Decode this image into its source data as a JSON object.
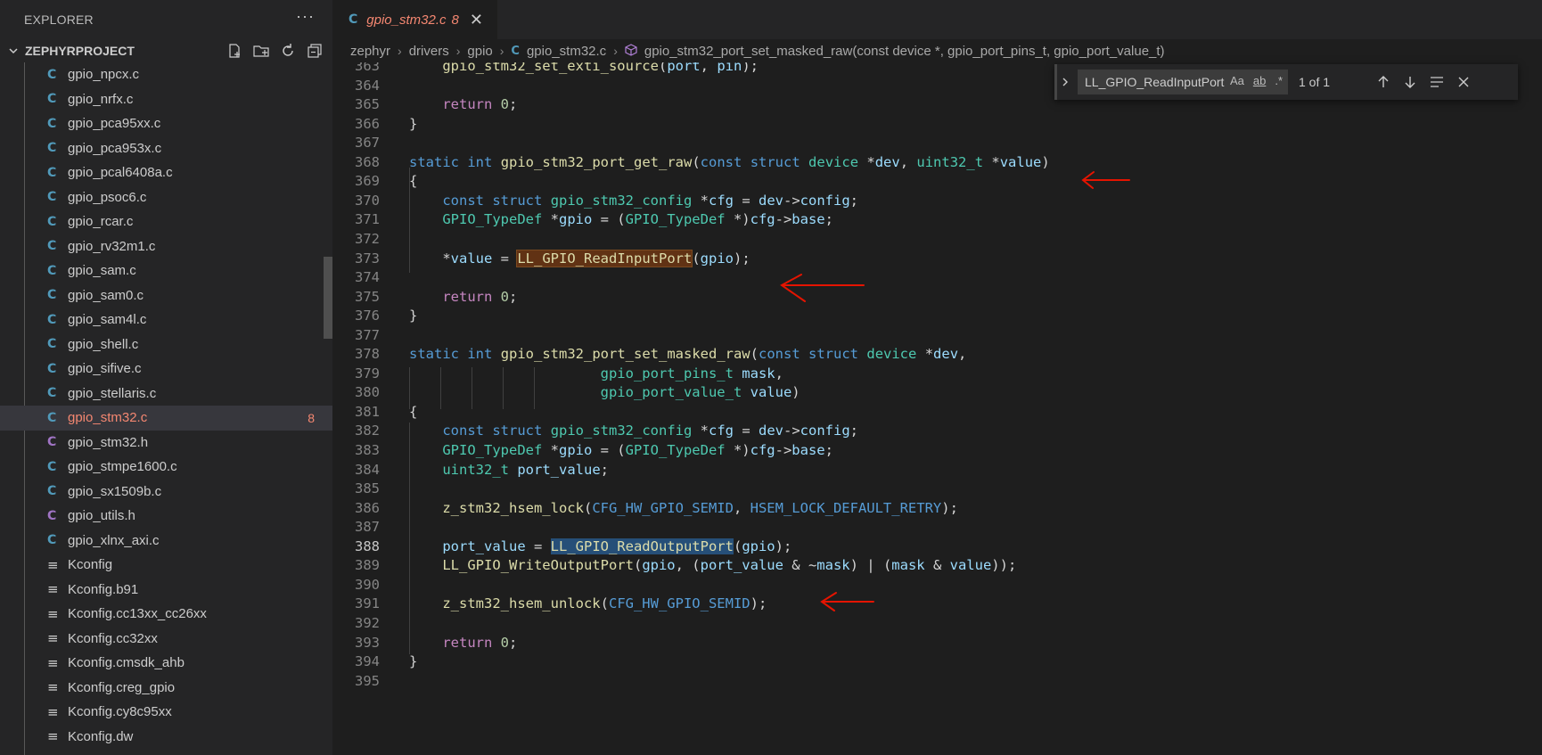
{
  "sidebar": {
    "title": "EXPLORER",
    "more": "···",
    "project": "ZEPHYRPROJECT",
    "files": [
      {
        "icon": "C",
        "kind": "c",
        "name": "gpio_npcx.c"
      },
      {
        "icon": "C",
        "kind": "c",
        "name": "gpio_nrfx.c"
      },
      {
        "icon": "C",
        "kind": "c",
        "name": "gpio_pca95xx.c"
      },
      {
        "icon": "C",
        "kind": "c",
        "name": "gpio_pca953x.c"
      },
      {
        "icon": "C",
        "kind": "c",
        "name": "gpio_pcal6408a.c"
      },
      {
        "icon": "C",
        "kind": "c",
        "name": "gpio_psoc6.c"
      },
      {
        "icon": "C",
        "kind": "c",
        "name": "gpio_rcar.c"
      },
      {
        "icon": "C",
        "kind": "c",
        "name": "gpio_rv32m1.c"
      },
      {
        "icon": "C",
        "kind": "c",
        "name": "gpio_sam.c"
      },
      {
        "icon": "C",
        "kind": "c",
        "name": "gpio_sam0.c"
      },
      {
        "icon": "C",
        "kind": "c",
        "name": "gpio_sam4l.c"
      },
      {
        "icon": "C",
        "kind": "c",
        "name": "gpio_shell.c"
      },
      {
        "icon": "C",
        "kind": "c",
        "name": "gpio_sifive.c"
      },
      {
        "icon": "C",
        "kind": "c",
        "name": "gpio_stellaris.c"
      },
      {
        "icon": "C",
        "kind": "c",
        "name": "gpio_stm32.c",
        "active": true,
        "badge": "8"
      },
      {
        "icon": "C",
        "kind": "h",
        "name": "gpio_stm32.h"
      },
      {
        "icon": "C",
        "kind": "c",
        "name": "gpio_stmpe1600.c"
      },
      {
        "icon": "C",
        "kind": "c",
        "name": "gpio_sx1509b.c"
      },
      {
        "icon": "C",
        "kind": "h",
        "name": "gpio_utils.h"
      },
      {
        "icon": "C",
        "kind": "c",
        "name": "gpio_xlnx_axi.c"
      },
      {
        "icon": "≡",
        "kind": "k",
        "name": "Kconfig"
      },
      {
        "icon": "≡",
        "kind": "k",
        "name": "Kconfig.b91"
      },
      {
        "icon": "≡",
        "kind": "k",
        "name": "Kconfig.cc13xx_cc26xx"
      },
      {
        "icon": "≡",
        "kind": "k",
        "name": "Kconfig.cc32xx"
      },
      {
        "icon": "≡",
        "kind": "k",
        "name": "Kconfig.cmsdk_ahb"
      },
      {
        "icon": "≡",
        "kind": "k",
        "name": "Kconfig.creg_gpio"
      },
      {
        "icon": "≡",
        "kind": "k",
        "name": "Kconfig.cy8c95xx"
      },
      {
        "icon": "≡",
        "kind": "k",
        "name": "Kconfig.dw"
      }
    ]
  },
  "tab": {
    "icon": "C",
    "name": "gpio_stm32.c",
    "count": "8",
    "close": "✕"
  },
  "breadcrumb": {
    "parts": [
      "zephyr",
      "drivers",
      "gpio"
    ],
    "file_icon": "C",
    "file": "gpio_stm32.c",
    "symbol": "gpio_stm32_port_set_masked_raw(const device *, gpio_port_pins_t, gpio_port_value_t)"
  },
  "find": {
    "query": "LL_GPIO_ReadInputPort",
    "match_case": "Aa",
    "whole_word": "ab",
    "regex": ".*",
    "count": "1 of 1"
  },
  "code": {
    "current_line": "388",
    "lines": [
      {
        "n": "363",
        "t": [
          [
            "pl",
            "    "
          ],
          [
            "fn",
            "gpio_stm32_set_exti_source"
          ],
          [
            "pl",
            "("
          ],
          [
            "id",
            "port"
          ],
          [
            "pl",
            ", "
          ],
          [
            "id",
            "pin"
          ],
          [
            "pl",
            ");"
          ]
        ]
      },
      {
        "n": "364",
        "t": []
      },
      {
        "n": "365",
        "t": [
          [
            "pl",
            "    "
          ],
          [
            "ctl",
            "return"
          ],
          [
            "pl",
            " "
          ],
          [
            "num",
            "0"
          ],
          [
            "pl",
            ";"
          ]
        ]
      },
      {
        "n": "366",
        "t": [
          [
            "pl",
            "}"
          ]
        ]
      },
      {
        "n": "367",
        "t": []
      },
      {
        "n": "368",
        "t": [
          [
            "kw",
            "static"
          ],
          [
            "pl",
            " "
          ],
          [
            "kw",
            "int"
          ],
          [
            "pl",
            " "
          ],
          [
            "fn",
            "gpio_stm32_port_get_raw"
          ],
          [
            "pl",
            "("
          ],
          [
            "kw",
            "const"
          ],
          [
            "pl",
            " "
          ],
          [
            "kw",
            "struct"
          ],
          [
            "pl",
            " "
          ],
          [
            "ty",
            "device"
          ],
          [
            "pl",
            " *"
          ],
          [
            "id",
            "dev"
          ],
          [
            "pl",
            ", "
          ],
          [
            "ty",
            "uint32_t"
          ],
          [
            "pl",
            " *"
          ],
          [
            "id",
            "value"
          ],
          [
            "pl",
            ")"
          ]
        ]
      },
      {
        "n": "369",
        "t": [
          [
            "pl",
            "{"
          ]
        ]
      },
      {
        "n": "370",
        "t": [
          [
            "pl",
            "    "
          ],
          [
            "kw",
            "const"
          ],
          [
            "pl",
            " "
          ],
          [
            "kw",
            "struct"
          ],
          [
            "pl",
            " "
          ],
          [
            "ty",
            "gpio_stm32_config"
          ],
          [
            "pl",
            " *"
          ],
          [
            "id",
            "cfg"
          ],
          [
            "pl",
            " = "
          ],
          [
            "id",
            "dev"
          ],
          [
            "pl",
            "->"
          ],
          [
            "id",
            "config"
          ],
          [
            "pl",
            ";"
          ]
        ]
      },
      {
        "n": "371",
        "t": [
          [
            "pl",
            "    "
          ],
          [
            "ty",
            "GPIO_TypeDef"
          ],
          [
            "pl",
            " *"
          ],
          [
            "id",
            "gpio"
          ],
          [
            "pl",
            " = ("
          ],
          [
            "ty",
            "GPIO_TypeDef"
          ],
          [
            "pl",
            " *)"
          ],
          [
            "id",
            "cfg"
          ],
          [
            "pl",
            "->"
          ],
          [
            "id",
            "base"
          ],
          [
            "pl",
            ";"
          ]
        ]
      },
      {
        "n": "372",
        "t": []
      },
      {
        "n": "373",
        "t": [
          [
            "pl",
            "    *"
          ],
          [
            "id",
            "value"
          ],
          [
            "pl",
            " = "
          ],
          [
            "fn hl-find",
            "LL_GPIO_ReadInputPort"
          ],
          [
            "pl",
            "("
          ],
          [
            "id",
            "gpio"
          ],
          [
            "pl",
            ");"
          ]
        ]
      },
      {
        "n": "374",
        "t": []
      },
      {
        "n": "375",
        "t": [
          [
            "pl",
            "    "
          ],
          [
            "ctl",
            "return"
          ],
          [
            "pl",
            " "
          ],
          [
            "num",
            "0"
          ],
          [
            "pl",
            ";"
          ]
        ]
      },
      {
        "n": "376",
        "t": [
          [
            "pl",
            "}"
          ]
        ]
      },
      {
        "n": "377",
        "t": []
      },
      {
        "n": "378",
        "t": [
          [
            "kw",
            "static"
          ],
          [
            "pl",
            " "
          ],
          [
            "kw",
            "int"
          ],
          [
            "pl",
            " "
          ],
          [
            "fn",
            "gpio_stm32_port_set_masked_raw"
          ],
          [
            "pl",
            "("
          ],
          [
            "kw",
            "const"
          ],
          [
            "pl",
            " "
          ],
          [
            "kw",
            "struct"
          ],
          [
            "pl",
            " "
          ],
          [
            "ty",
            "device"
          ],
          [
            "pl",
            " *"
          ],
          [
            "id",
            "dev"
          ],
          [
            "pl",
            ","
          ]
        ]
      },
      {
        "n": "379",
        "t": [
          [
            "pl",
            "                       "
          ],
          [
            "ty",
            "gpio_port_pins_t"
          ],
          [
            "pl",
            " "
          ],
          [
            "id",
            "mask"
          ],
          [
            "pl",
            ","
          ]
        ]
      },
      {
        "n": "380",
        "t": [
          [
            "pl",
            "                       "
          ],
          [
            "ty",
            "gpio_port_value_t"
          ],
          [
            "pl",
            " "
          ],
          [
            "id",
            "value"
          ],
          [
            "pl",
            ")"
          ]
        ]
      },
      {
        "n": "381",
        "t": [
          [
            "pl",
            "{"
          ]
        ]
      },
      {
        "n": "382",
        "t": [
          [
            "pl",
            "    "
          ],
          [
            "kw",
            "const"
          ],
          [
            "pl",
            " "
          ],
          [
            "kw",
            "struct"
          ],
          [
            "pl",
            " "
          ],
          [
            "ty",
            "gpio_stm32_config"
          ],
          [
            "pl",
            " *"
          ],
          [
            "id",
            "cfg"
          ],
          [
            "pl",
            " = "
          ],
          [
            "id",
            "dev"
          ],
          [
            "pl",
            "->"
          ],
          [
            "id",
            "config"
          ],
          [
            "pl",
            ";"
          ]
        ]
      },
      {
        "n": "383",
        "t": [
          [
            "pl",
            "    "
          ],
          [
            "ty",
            "GPIO_TypeDef"
          ],
          [
            "pl",
            " *"
          ],
          [
            "id",
            "gpio"
          ],
          [
            "pl",
            " = ("
          ],
          [
            "ty",
            "GPIO_TypeDef"
          ],
          [
            "pl",
            " *)"
          ],
          [
            "id",
            "cfg"
          ],
          [
            "pl",
            "->"
          ],
          [
            "id",
            "base"
          ],
          [
            "pl",
            ";"
          ]
        ]
      },
      {
        "n": "384",
        "t": [
          [
            "pl",
            "    "
          ],
          [
            "ty",
            "uint32_t"
          ],
          [
            "pl",
            " "
          ],
          [
            "id",
            "port_value"
          ],
          [
            "pl",
            ";"
          ]
        ]
      },
      {
        "n": "385",
        "t": []
      },
      {
        "n": "386",
        "t": [
          [
            "pl",
            "    "
          ],
          [
            "fn",
            "z_stm32_hsem_lock"
          ],
          [
            "pl",
            "("
          ],
          [
            "mac",
            "CFG_HW_GPIO_SEMID"
          ],
          [
            "pl",
            ", "
          ],
          [
            "mac",
            "HSEM_LOCK_DEFAULT_RETRY"
          ],
          [
            "pl",
            ");"
          ]
        ]
      },
      {
        "n": "387",
        "t": []
      },
      {
        "n": "388",
        "t": [
          [
            "pl",
            "    "
          ],
          [
            "id",
            "port_value"
          ],
          [
            "pl",
            " = "
          ],
          [
            "fn hl-sel",
            "LL_GPIO_ReadOutputPort"
          ],
          [
            "pl",
            "("
          ],
          [
            "id",
            "gpio"
          ],
          [
            "pl",
            ");"
          ]
        ]
      },
      {
        "n": "389",
        "t": [
          [
            "pl",
            "    "
          ],
          [
            "fn",
            "LL_GPIO_WriteOutputPort"
          ],
          [
            "pl",
            "("
          ],
          [
            "id",
            "gpio"
          ],
          [
            "pl",
            ", ("
          ],
          [
            "id",
            "port_value"
          ],
          [
            "pl",
            " & ~"
          ],
          [
            "id",
            "mask"
          ],
          [
            "pl",
            ") | ("
          ],
          [
            "id",
            "mask"
          ],
          [
            "pl",
            " & "
          ],
          [
            "id",
            "value"
          ],
          [
            "pl",
            "));"
          ]
        ]
      },
      {
        "n": "390",
        "t": []
      },
      {
        "n": "391",
        "t": [
          [
            "pl",
            "    "
          ],
          [
            "fn",
            "z_stm32_hsem_unlock"
          ],
          [
            "pl",
            "("
          ],
          [
            "mac",
            "CFG_HW_GPIO_SEMID"
          ],
          [
            "pl",
            ");"
          ]
        ]
      },
      {
        "n": "392",
        "t": []
      },
      {
        "n": "393",
        "t": [
          [
            "pl",
            "    "
          ],
          [
            "ctl",
            "return"
          ],
          [
            "pl",
            " "
          ],
          [
            "num",
            "0"
          ],
          [
            "pl",
            ";"
          ]
        ]
      },
      {
        "n": "394",
        "t": [
          [
            "pl",
            "}"
          ]
        ]
      },
      {
        "n": "395",
        "t": []
      }
    ]
  },
  "colors": {
    "annotation_arrow": "#e51400",
    "find_highlight": "#613214",
    "selection": "#264f78",
    "error": "#f48771"
  }
}
